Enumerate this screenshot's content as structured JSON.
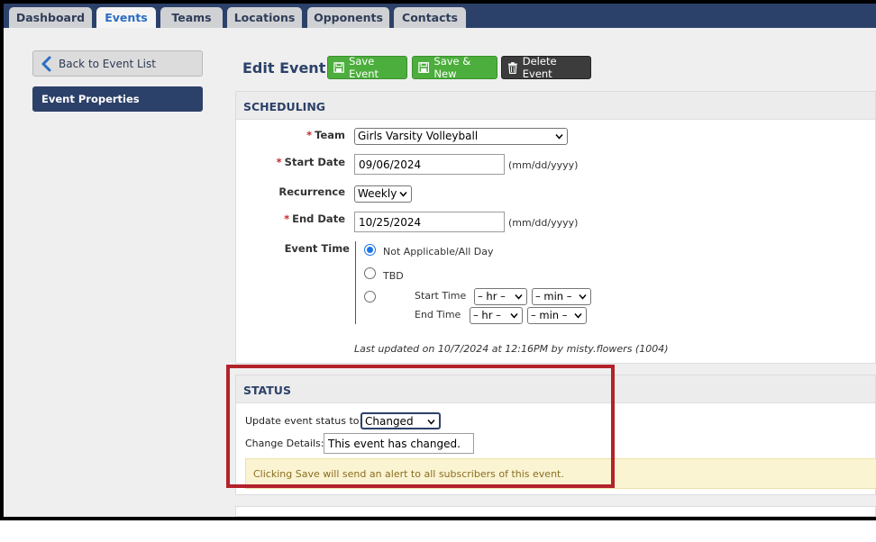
{
  "tabs": [
    {
      "label": "Dashboard"
    },
    {
      "label": "Events"
    },
    {
      "label": "Teams"
    },
    {
      "label": "Locations"
    },
    {
      "label": "Opponents"
    },
    {
      "label": "Contacts"
    }
  ],
  "sidebar": {
    "back_label": "Back to Event List",
    "nav_label": "Event Properties"
  },
  "header": {
    "title": "Edit Event",
    "save_label": "Save Event",
    "save_new_label": "Save & New",
    "delete_label": "Delete Event"
  },
  "scheduling": {
    "title": "SCHEDULING",
    "team_label": "Team",
    "team_value": "Girls Varsity Volleyball",
    "start_date_label": "Start Date",
    "start_date_value": "09/06/2024",
    "date_hint": "(mm/dd/yyyy)",
    "recurrence_label": "Recurrence",
    "recurrence_value": "Weekly",
    "end_date_label": "End Date",
    "end_date_value": "10/25/2024",
    "event_time_label": "Event Time",
    "option_all_day": "Not Applicable/All Day",
    "option_tbd": "TBD",
    "start_time_label": "Start Time",
    "end_time_label": "End Time",
    "hr_placeholder": "– hr –",
    "min_placeholder": "– min –",
    "required_mark": "*",
    "last_updated": "Last updated on 10/7/2024 at 12:16PM by misty.flowers (1004)"
  },
  "status": {
    "title": "STATUS",
    "update_label": "Update event status to:",
    "status_value": "Changed",
    "details_label": "Change Details:",
    "details_value": "This event has changed.",
    "alert_text": "Clicking Save will send an alert to all subscribers of this event."
  },
  "colors": {
    "nav": "#2c4169",
    "active_tab_text": "#2b6cc4",
    "green": "#4cae3c",
    "highlight": "#b3222a",
    "alert_bg": "#fbf4d2"
  }
}
